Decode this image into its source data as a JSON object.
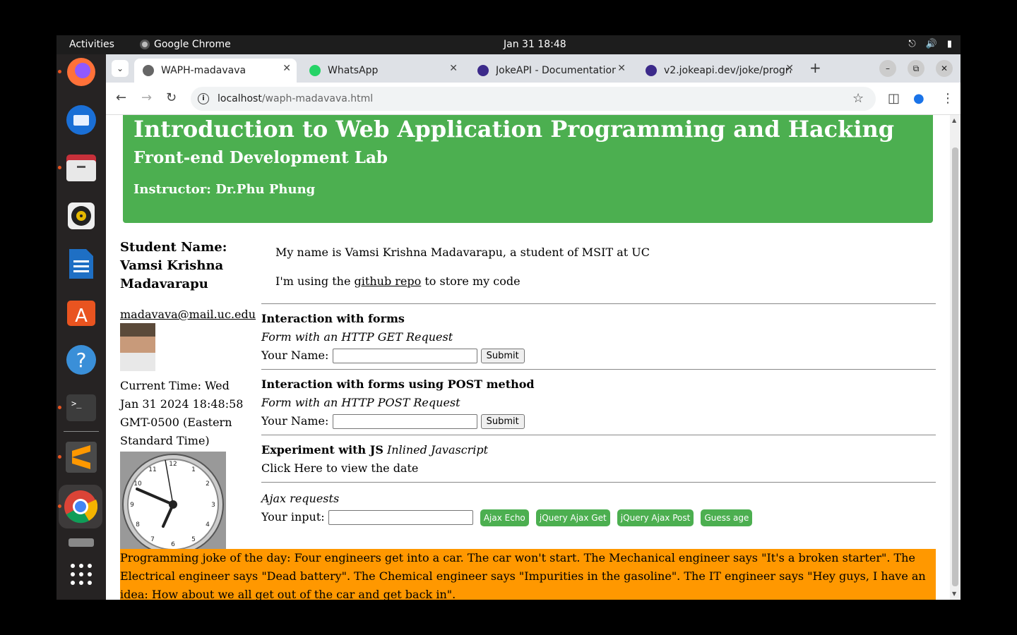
{
  "topbar": {
    "activities": "Activities",
    "app_name": "Google Chrome",
    "clock": "Jan 31  18:48",
    "tray_icons": [
      "network-icon",
      "volume-icon",
      "battery-icon"
    ]
  },
  "dock": {
    "items": [
      "firefox-icon",
      "thunderbird-icon",
      "files-icon",
      "rhythmbox-icon",
      "writer-icon",
      "app-center-icon",
      "help-icon",
      "terminal-icon",
      "sublime-icon",
      "chrome-icon",
      "drive-icon",
      "app-grid-icon"
    ]
  },
  "browser": {
    "tabs": [
      {
        "title": "WAPH-madavava",
        "icon": "globe-icon"
      },
      {
        "title": "WhatsApp",
        "icon": "whatsapp-icon"
      },
      {
        "title": "JokeAPI - Documentation",
        "icon": "jokeapi-icon"
      },
      {
        "title": "v2.jokeapi.dev/joke/programming",
        "icon": "jokeapi-icon"
      }
    ],
    "url_host": "localhost",
    "url_path": "/waph-madavava.html"
  },
  "page": {
    "header": {
      "title": "Introduction to Web Application Programming and Hacking",
      "subtitle": "Front-end Development Lab",
      "instructor": "Instructor: Dr.Phu Phung"
    },
    "student": {
      "name": "Student Name: Vamsi Krishna Madavarapu",
      "email": "madavava@mail.uc.edu",
      "time": "Current Time: Wed Jan 31 2024 18:48:58 GMT-0500 (Eastern Standard Time)"
    },
    "intro": {
      "line1": "My name is Vamsi Krishna Madavarapu, a student of MSIT at UC",
      "line2_pre": "I'm using the",
      "line2_link": "github repo",
      "line2_post": "to store my code"
    },
    "get_form": {
      "heading": "Interaction with forms",
      "sub": "Form with an HTTP GET Request",
      "label": "Your Name:",
      "button": "Submit"
    },
    "post_form": {
      "heading": "Interaction with forms using POST method",
      "sub": "Form with an HTTP POST Request",
      "label": "Your Name:",
      "button": "Submit"
    },
    "js": {
      "heading": "Experiment with JS",
      "heading_italic": "Inlined Javascript",
      "click_text": "Click Here to view the date"
    },
    "ajax": {
      "heading": "Ajax requests",
      "label": "Your input:",
      "buttons": [
        "Ajax Echo",
        "jQuery Ajax Get",
        "jQuery Ajax Post",
        "Guess age"
      ]
    },
    "joke": "Programming joke of the day: Four engineers get into a car. The car won't start. The Mechanical engineer says \"It's a broken starter\". The Electrical engineer says \"Dead battery\". The Chemical engineer says \"Impurities in the gasoline\". The IT engineer says \"Hey guys, I have an idea: How about we all get out of the car and get back in\"."
  }
}
